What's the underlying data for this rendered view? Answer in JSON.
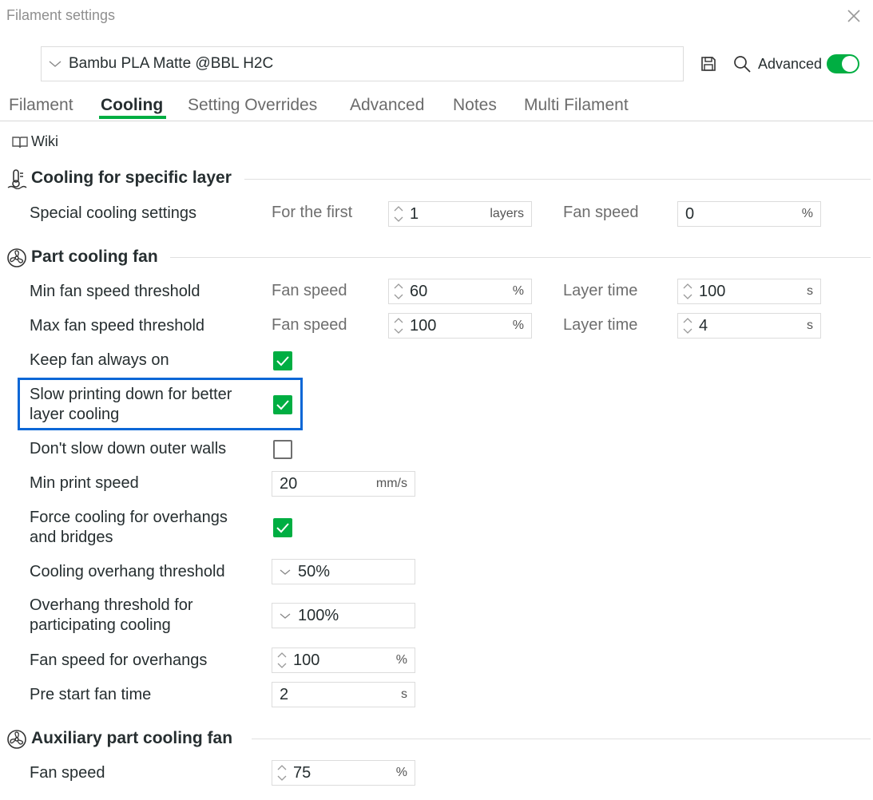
{
  "window": {
    "title": "Filament settings"
  },
  "toolbar": {
    "preset_name": "Bambu PLA Matte @BBL H2C",
    "advanced_label": "Advanced",
    "advanced_on": true
  },
  "tabs": [
    {
      "label": "Filament",
      "active": false
    },
    {
      "label": "Cooling",
      "active": true
    },
    {
      "label": "Setting Overrides",
      "active": false
    },
    {
      "label": "Advanced",
      "active": false
    },
    {
      "label": "Notes",
      "active": false
    },
    {
      "label": "Multi Filament",
      "active": false
    }
  ],
  "wiki_label": "Wiki",
  "sections": {
    "specific_layer": {
      "title": "Cooling for specific layer",
      "special": {
        "label": "Special cooling settings",
        "first_label": "For the first",
        "first_value": "1",
        "first_unit": "layers",
        "fan_label": "Fan speed",
        "fan_value": "0",
        "fan_unit": "%"
      }
    },
    "part_fan": {
      "title": "Part cooling fan",
      "min_threshold": {
        "label": "Min fan speed threshold",
        "fan_label": "Fan speed",
        "fan_value": "60",
        "fan_unit": "%",
        "time_label": "Layer time",
        "time_value": "100",
        "time_unit": "s"
      },
      "max_threshold": {
        "label": "Max fan speed threshold",
        "fan_label": "Fan speed",
        "fan_value": "100",
        "fan_unit": "%",
        "time_label": "Layer time",
        "time_value": "4",
        "time_unit": "s"
      },
      "keep_fan": {
        "label": "Keep fan always on",
        "checked": true
      },
      "slow_down": {
        "label_line1": "Slow printing down for better",
        "label_line2": "layer cooling",
        "checked": true
      },
      "dont_slow_outer": {
        "label": "Don't slow down outer walls",
        "checked": false
      },
      "min_print_speed": {
        "label": "Min print speed",
        "value": "20",
        "unit": "mm/s"
      },
      "force_cooling": {
        "label_line1": "Force cooling for overhangs",
        "label_line2": "and bridges",
        "checked": true
      },
      "overhang_threshold": {
        "label": "Cooling overhang threshold",
        "value": "50%"
      },
      "participating": {
        "label_line1": "Overhang threshold for",
        "label_line2": "participating cooling",
        "value": "100%"
      },
      "overhang_fan": {
        "label": "Fan speed for overhangs",
        "value": "100",
        "unit": "%"
      },
      "pre_start": {
        "label": "Pre start fan time",
        "value": "2",
        "unit": "s"
      }
    },
    "aux_fan": {
      "title": "Auxiliary part cooling fan",
      "fan_speed": {
        "label": "Fan speed",
        "value": "75",
        "unit": "%"
      }
    }
  },
  "colors": {
    "accent": "#00ae42",
    "highlight": "#0b67d6"
  }
}
